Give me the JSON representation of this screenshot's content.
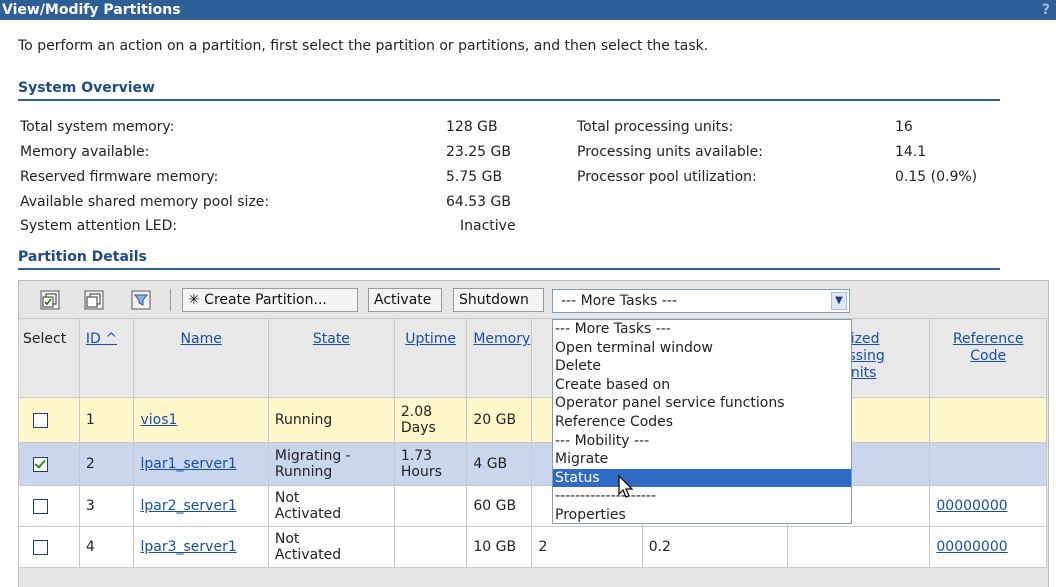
{
  "window": {
    "title": "View/Modify Partitions",
    "help": "?"
  },
  "instructions": "To perform an action on a partition, first select the partition or partitions, and then select the task.",
  "system_overview": {
    "heading": "System Overview",
    "left": [
      {
        "label": "Total system memory:",
        "value": "128 GB"
      },
      {
        "label": "Memory available:",
        "value": "23.25 GB"
      },
      {
        "label": "Reserved firmware memory:",
        "value": "5.75 GB"
      },
      {
        "label": "Available shared memory pool size:",
        "value": "64.53 GB"
      },
      {
        "label": "System attention LED:",
        "value": "Inactive"
      }
    ],
    "right": [
      {
        "label": "Total processing units:",
        "value": "16"
      },
      {
        "label": "Processing units available:",
        "value": "14.1"
      },
      {
        "label": "Processor pool utilization:",
        "value": "0.15 (0.9%)"
      }
    ]
  },
  "partition_details": {
    "heading": "Partition Details",
    "toolbar": {
      "create_label": "✳ Create Partition...",
      "activate_label": "Activate",
      "shutdown_label": "Shutdown",
      "more_tasks_value": "--- More Tasks ---"
    },
    "more_tasks_options": [
      "--- More Tasks ---",
      "Open terminal window",
      "Delete",
      "Create based on",
      "Operator panel service functions",
      "Reference Codes",
      "--- Mobility ---",
      "Migrate",
      "Status",
      "--------------------",
      "Properties"
    ],
    "highlighted_option": "Status",
    "columns": {
      "select": "Select",
      "id": "ID ^",
      "name": "Name",
      "state": "State",
      "uptime": "Uptime",
      "memory": "Memory",
      "processors": "",
      "entitled": "",
      "utilized_line1": "tilized",
      "utilized_line2": "cessing",
      "utilized_line3": "Units",
      "refcode_line1": "Reference",
      "refcode_line2": "Code"
    },
    "rows": [
      {
        "checked": false,
        "id": "1",
        "name": "vios1",
        "state": "Running",
        "uptime_line1": "2.08",
        "uptime_line2": "Days",
        "memory": "20 GB",
        "processors": "",
        "proc_units": "",
        "utilized": "",
        "refcode": ""
      },
      {
        "checked": true,
        "id": "2",
        "name": "lpar1_server1",
        "state_line1": "Migrating -",
        "state_line2": "Running",
        "uptime_line1": "1.73",
        "uptime_line2": "Hours",
        "memory": "4 GB",
        "processors": "",
        "proc_units": "",
        "utilized": "",
        "refcode": ""
      },
      {
        "checked": false,
        "id": "3",
        "name": "lpar2_server1",
        "state_line1": "Not",
        "state_line2": "Activated",
        "uptime_line1": "",
        "uptime_line2": "",
        "memory": "60 GB",
        "processors": "",
        "proc_units": "",
        "utilized": "",
        "refcode": "00000000"
      },
      {
        "checked": false,
        "id": "4",
        "name": "lpar3_server1",
        "state_line1": "Not",
        "state_line2": "Activated",
        "uptime_line1": "",
        "uptime_line2": "",
        "memory": "10 GB",
        "processors": "2",
        "proc_units": "0.2",
        "utilized": "",
        "refcode": "00000000"
      }
    ]
  },
  "colors": {
    "title_bar": "#2e5e96",
    "section_heading": "#1f4a86",
    "selected_row": "#c9d6ee",
    "first_row": "#fff8cc",
    "highlight": "#316ac5",
    "link": "#1a4fa0"
  }
}
